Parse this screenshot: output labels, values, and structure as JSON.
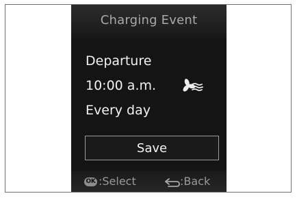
{
  "screen": {
    "title": "Charging Event",
    "event": {
      "label": "Departure",
      "time": "10:00 a.m.",
      "repeat": "Every day",
      "climate_icon": "fan-airflow-icon"
    },
    "save_label": "Save",
    "footer": {
      "ok_badge": "OK",
      "select_label": ":Select",
      "back_icon": "return-arrow-icon",
      "back_label": ":Back"
    }
  },
  "colors": {
    "screen_background": "#141414",
    "title_text": "#a9a9a9",
    "body_text": "#f2f2f2",
    "button_border": "#9c9c9c",
    "footer_text": "#9a9a9a"
  }
}
